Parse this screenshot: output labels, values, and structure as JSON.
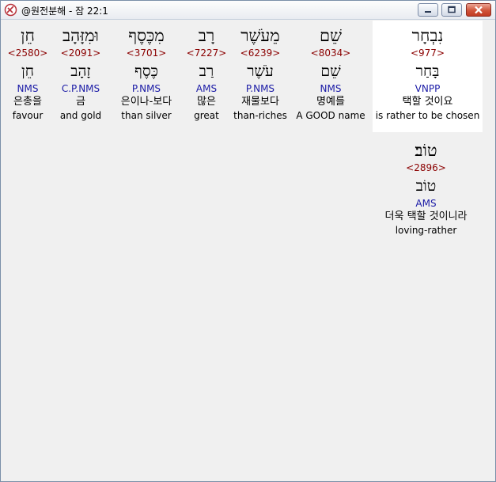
{
  "window": {
    "title": "@원전분해 - 잠 22:1",
    "colors": {
      "strong": "#8b0000",
      "morph": "#1a1aa6",
      "selected_bg": "#ffffff"
    }
  },
  "words": [
    {
      "hebrew": "נִבְחָר",
      "strong": "<977>",
      "lemma": "בָּחַר",
      "morph": "VNPP",
      "korean": "택할 것이요",
      "english": "is rather to be chosen",
      "selected": true
    },
    {
      "hebrew": "שֵׁם",
      "strong": "<8034>",
      "lemma": "שֵׁם",
      "morph": "NMS",
      "korean": "명예를",
      "english": "A GOOD name"
    },
    {
      "hebrew": "מֵעֹשֶׁר",
      "strong": "<6239>",
      "lemma": "עֹשֶׁר",
      "morph": "P.NMS",
      "korean": "재물보다",
      "english": "than-riches"
    },
    {
      "hebrew": "רָב",
      "strong": "<7227>",
      "lemma": "רַב",
      "morph": "AMS",
      "korean": "많은",
      "english": "great"
    },
    {
      "hebrew": "מִכֶּסֶף",
      "strong": "<3701>",
      "lemma": "כֶּסֶף",
      "morph": "P.NMS",
      "korean": "은이나-보다",
      "english": "than silver"
    },
    {
      "hebrew": "וּמִזָּהָב",
      "strong": "<2091>",
      "lemma": "זָהָב",
      "morph": "C.P.NMS",
      "korean": "금",
      "english": "and gold"
    },
    {
      "hebrew": "חֵן",
      "strong": "<2580>",
      "lemma": "חֵן",
      "morph": "NMS",
      "korean": "은총을",
      "english": "favour"
    },
    {
      "hebrew": "טוֹב׃",
      "strong": "<2896>",
      "lemma": "טוֹב",
      "morph": "AMS",
      "korean": "더욱 택할 것이니라",
      "english": "loving-rather"
    }
  ]
}
